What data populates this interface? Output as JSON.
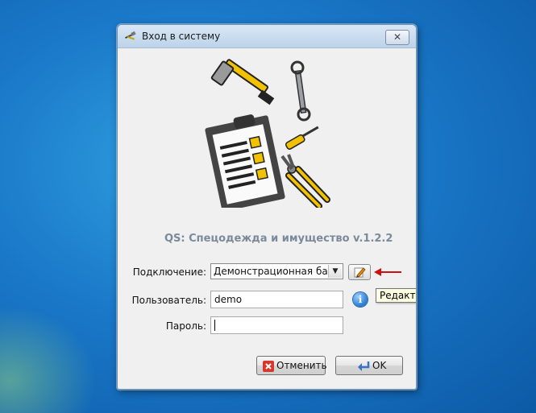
{
  "window": {
    "title": "Вход в систему",
    "close_glyph": "✕",
    "title_icon": "tools-icon"
  },
  "app": {
    "title": "QS: Спецодежда и имущество v.1.2.2",
    "logo_icon": "tools-clipboard-logo"
  },
  "form": {
    "connection_label": "Подключение:",
    "connection_value": "Демонстрационная база",
    "connection_editor_tooltip": "Редактор подключений",
    "user_label": "Пользователь:",
    "user_value": "demo",
    "password_label": "Пароль:",
    "password_value": "",
    "info_glyph": "i"
  },
  "buttons": {
    "cancel_label": "Отменить",
    "ok_label": "OK"
  },
  "colors": {
    "desktop": "#1a78c8",
    "annotation_arrow": "#cc1111",
    "title_text": "#7a8a9a"
  }
}
